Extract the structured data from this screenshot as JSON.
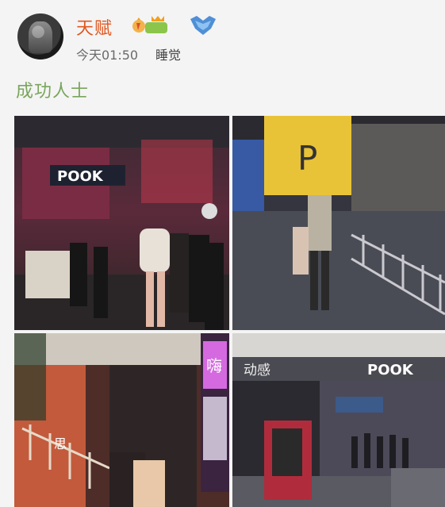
{
  "post": {
    "username": "天赋",
    "time": "今天01:50",
    "source": "睡觉",
    "text": "成功人士"
  },
  "photo_texts": {
    "p1_sign": "POOK",
    "p2_parking": "P",
    "p3_neon": "嗨",
    "p3_stair_sign": "思",
    "p4_sign_left": "动感",
    "p4_sign_right": "POOK"
  },
  "colors": {
    "username": "#e0571f",
    "post_text": "#7aa55c",
    "meta": "#6a6a6a"
  }
}
